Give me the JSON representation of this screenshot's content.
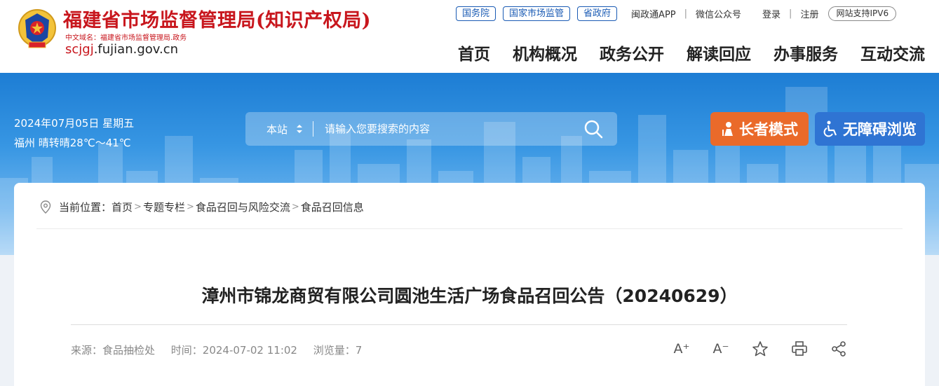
{
  "header": {
    "site_name": "福建省市场监督管理局(知识产权局)",
    "cn_domain": "中文域名：福建省市场监督管理局.政务",
    "en_domain_prefix": "scjgj",
    "en_domain_suffix": ".fujian.gov.cn",
    "top_links": [
      "国务院",
      "国家市场监管",
      "省政府"
    ],
    "app_link": "闽政通APP",
    "wechat_link": "微信公众号",
    "login": "登录",
    "register": "注册",
    "ipv6": "网站支持IPV6",
    "nav": [
      "首页",
      "机构概况",
      "政务公开",
      "解读回应",
      "办事服务",
      "互动交流"
    ]
  },
  "banner": {
    "date": "2024年07月05日 星期五",
    "weather": "福州 晴转晴28℃～41℃",
    "search_scope": "本站",
    "search_placeholder": "请输入您要搜索的内容",
    "elder_mode": "长者模式",
    "accessible": "无障碍浏览"
  },
  "breadcrumb": {
    "label": "当前位置：",
    "items": [
      "首页",
      "专题专栏",
      "食品召回与风险交流",
      "食品召回信息"
    ]
  },
  "article": {
    "title": "漳州市锦龙商贸有限公司圆池生活广场食品召回公告（20240629）",
    "source": "来源：食品抽检处",
    "time": "时间：2024-07-02 11:02",
    "views": "浏览量：7"
  },
  "tools": {
    "font_larger": "A⁺",
    "font_smaller": "A⁻"
  },
  "colors": {
    "brand_red": "#c8161d",
    "nav_blue": "#1a5bb4",
    "elder_orange": "#ea6a2a",
    "access_blue": "#2f74d3"
  }
}
